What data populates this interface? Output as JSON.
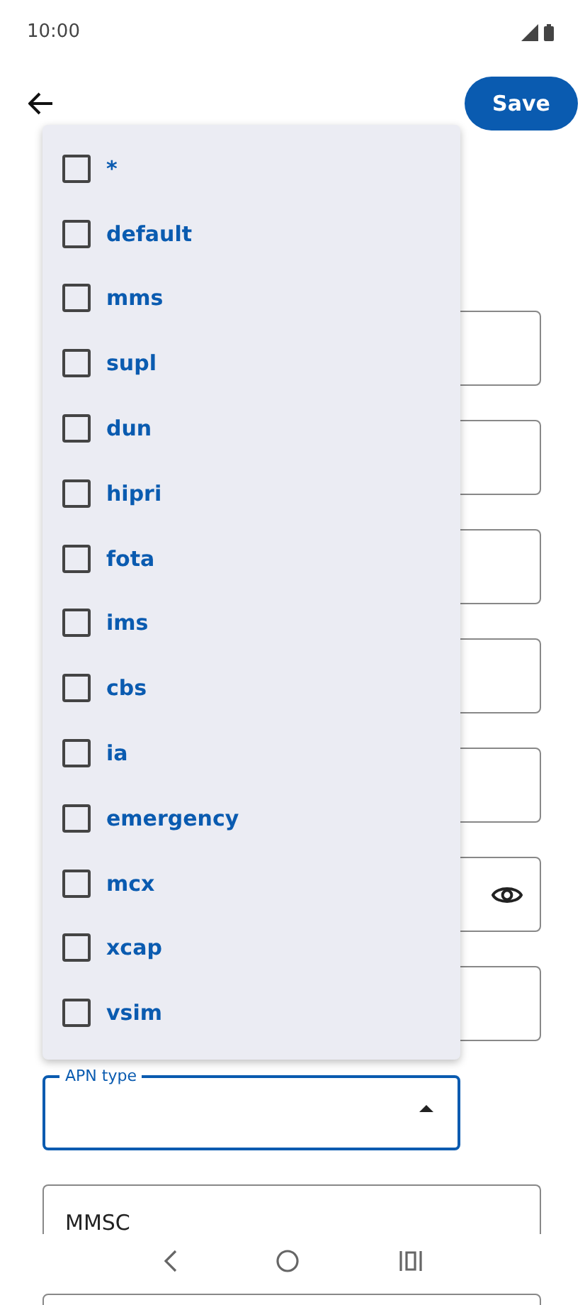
{
  "status_bar": {
    "time": "10:00"
  },
  "header": {
    "save_label": "Save"
  },
  "fields": [
    {
      "kind": "text"
    },
    {
      "kind": "text"
    },
    {
      "kind": "text"
    },
    {
      "kind": "text"
    },
    {
      "kind": "text"
    },
    {
      "kind": "password"
    },
    {
      "kind": "text"
    }
  ],
  "apn_type": {
    "label": "APN type",
    "focused": true,
    "expanded": true
  },
  "mmsc": {
    "label": "MMSC"
  },
  "menu": {
    "options": [
      {
        "label": "*",
        "checked": false
      },
      {
        "label": "default",
        "checked": false
      },
      {
        "label": "mms",
        "checked": false
      },
      {
        "label": "supl",
        "checked": false
      },
      {
        "label": "dun",
        "checked": false
      },
      {
        "label": "hipri",
        "checked": false
      },
      {
        "label": "fota",
        "checked": false
      },
      {
        "label": "ims",
        "checked": false
      },
      {
        "label": "cbs",
        "checked": false
      },
      {
        "label": "ia",
        "checked": false
      },
      {
        "label": "emergency",
        "checked": false
      },
      {
        "label": "mcx",
        "checked": false
      },
      {
        "label": "xcap",
        "checked": false
      },
      {
        "label": "vsim",
        "checked": false
      }
    ]
  }
}
